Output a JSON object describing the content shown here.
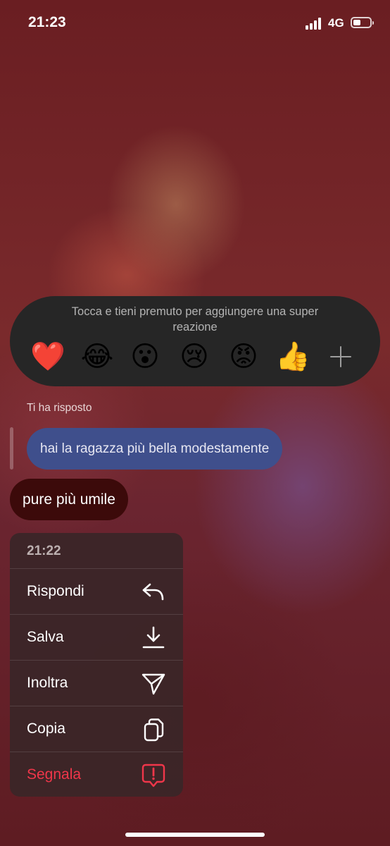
{
  "status": {
    "time": "21:23",
    "network": "4G"
  },
  "reactions": {
    "hint": "Tocca e tieni premuto per aggiungere una super reazione",
    "emojis": [
      "❤️",
      "😂",
      "😮",
      "😢",
      "😡",
      "👍"
    ],
    "more_icon": "plus-icon"
  },
  "conversation": {
    "reply_label": "Ti ha risposto",
    "quoted_message": "hai la ragazza più bella modestamente",
    "message": "pure più umile"
  },
  "menu": {
    "timestamp": "21:22",
    "items": [
      {
        "label": "Rispondi",
        "icon": "reply-arrow-icon"
      },
      {
        "label": "Salva",
        "icon": "download-icon"
      },
      {
        "label": "Inoltra",
        "icon": "send-icon"
      },
      {
        "label": "Copia",
        "icon": "copy-icon"
      },
      {
        "label": "Segnala",
        "icon": "report-icon",
        "color": "#f0364a"
      }
    ]
  }
}
